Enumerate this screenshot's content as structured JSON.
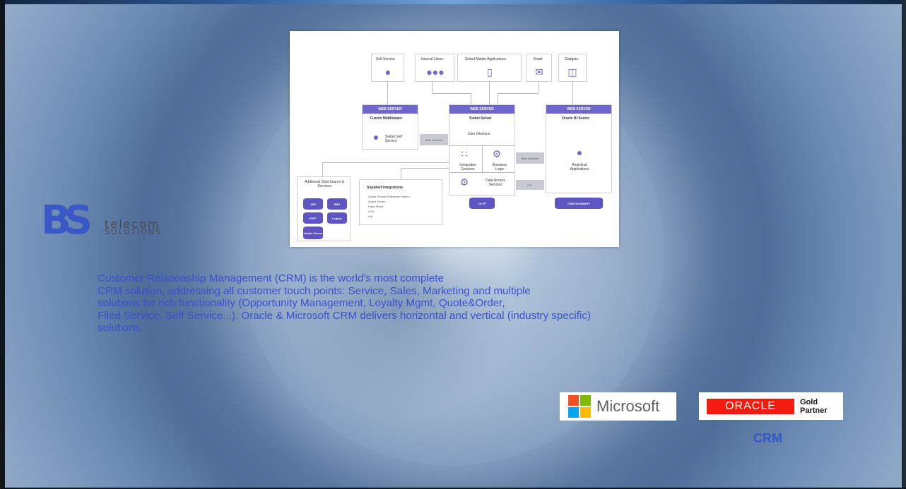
{
  "diagram": {
    "top_nodes": [
      "Self Service",
      "Internal Users",
      "Siebel Mobile Applications",
      "Email",
      "Gadgets"
    ],
    "servers": [
      {
        "header": "WEB SERVER",
        "title": "Fusion Middleware",
        "sub": "Siebel Self Service"
      },
      {
        "header": "WEB SERVER",
        "title": "Siebel Server",
        "ui": "User Interface",
        "cells": [
          "Integration Services",
          "Business Logic",
          "Data Access Services"
        ]
      },
      {
        "header": "WEB SERVER",
        "title": "Oracle BI Server",
        "sub": "Analytical Applications"
      }
    ],
    "arrows": [
      "Web Services",
      "Web Services",
      "ETL"
    ],
    "additional": {
      "title": "Additional Data Source & Services",
      "items": [
        "JDE",
        "EBS",
        "PSFT",
        "Legacy",
        "Adobe Forms"
      ]
    },
    "integrations": {
      "title": "Supplied Integrations",
      "items": [
        "Oracle Secure Enterprise Search",
        "Adobe Forms",
        "Haley Rules",
        "CCA",
        "AIA"
      ]
    },
    "db_labels": [
      "OLTP",
      "CRM DATAMART"
    ]
  },
  "logo": {
    "bs": "BS",
    "line1": "telecom",
    "line2": "SOLUTIONS"
  },
  "description": [
    "Customer Relationship Management (CRM) is the world's most complete",
    "CRM solution, addressing all customer touch points: Service, Sales, Marketing and multiple",
    "solutions for rich functionality (Opportunity Management, Loyalty Mgmt, Quote&Order,",
    "Filed Service, Self Service...). Oracle & Microsoft CRM delivers horizontal and vertical (industry specific)",
    "solutions."
  ],
  "partners": {
    "microsoft": "Microsoft",
    "oracle": "ORACLE",
    "gold_partner_line1": "Gold",
    "gold_partner_line2": "Partner",
    "crm_label": "CRM"
  },
  "colors": {
    "text_blue": "#3a4fd0",
    "diagram_purple": "#6f66cc",
    "oracle_red": "#f31a10"
  }
}
